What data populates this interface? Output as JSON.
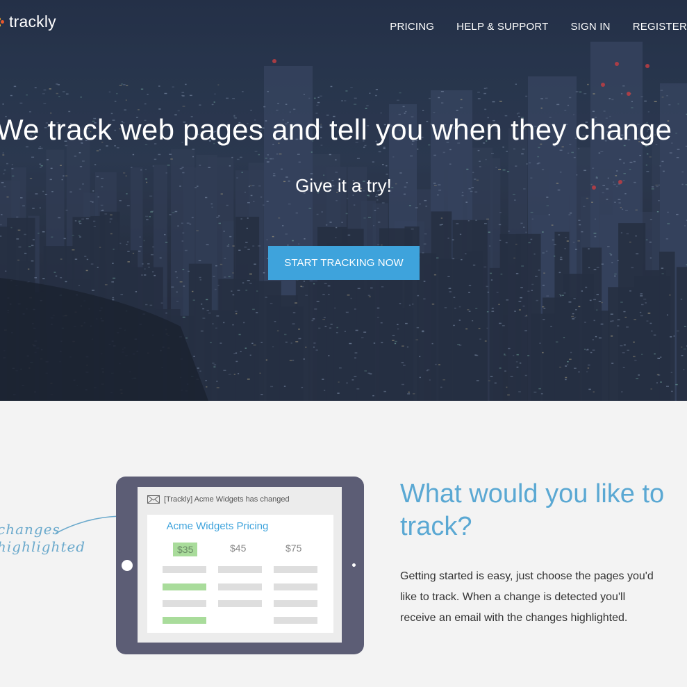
{
  "brand": {
    "name": "trackly"
  },
  "nav": [
    {
      "label": "PRICING"
    },
    {
      "label": "HELP & SUPPORT"
    },
    {
      "label": "SIGN IN"
    },
    {
      "label": "REGISTER"
    }
  ],
  "hero": {
    "headline": "We track web pages and tell you when they change",
    "subheadline": "Give it a try!",
    "cta_label": "START TRACKING NOW"
  },
  "illustration": {
    "hand_note_line1": "changes",
    "hand_note_line2": "highlighted",
    "email_subject": "[Trackly] Acme Widgets has changed",
    "card_title": "Acme Widgets Pricing",
    "prices": [
      "$35",
      "$45",
      "$75"
    ],
    "icons": {
      "email": "envelope-icon"
    }
  },
  "feature": {
    "title": "What would you like to track?",
    "body": "Getting started is easy, just choose the pages you'd like to track. When a change is detected you'll receive an email with the changes highlighted."
  },
  "colors": {
    "accent": "#3ea3dc",
    "highlight_green": "#a9dc9b",
    "tablet": "#5c5d75",
    "logo_dots": [
      "#f2a32c",
      "#e8582c",
      "#f2c02c"
    ]
  }
}
